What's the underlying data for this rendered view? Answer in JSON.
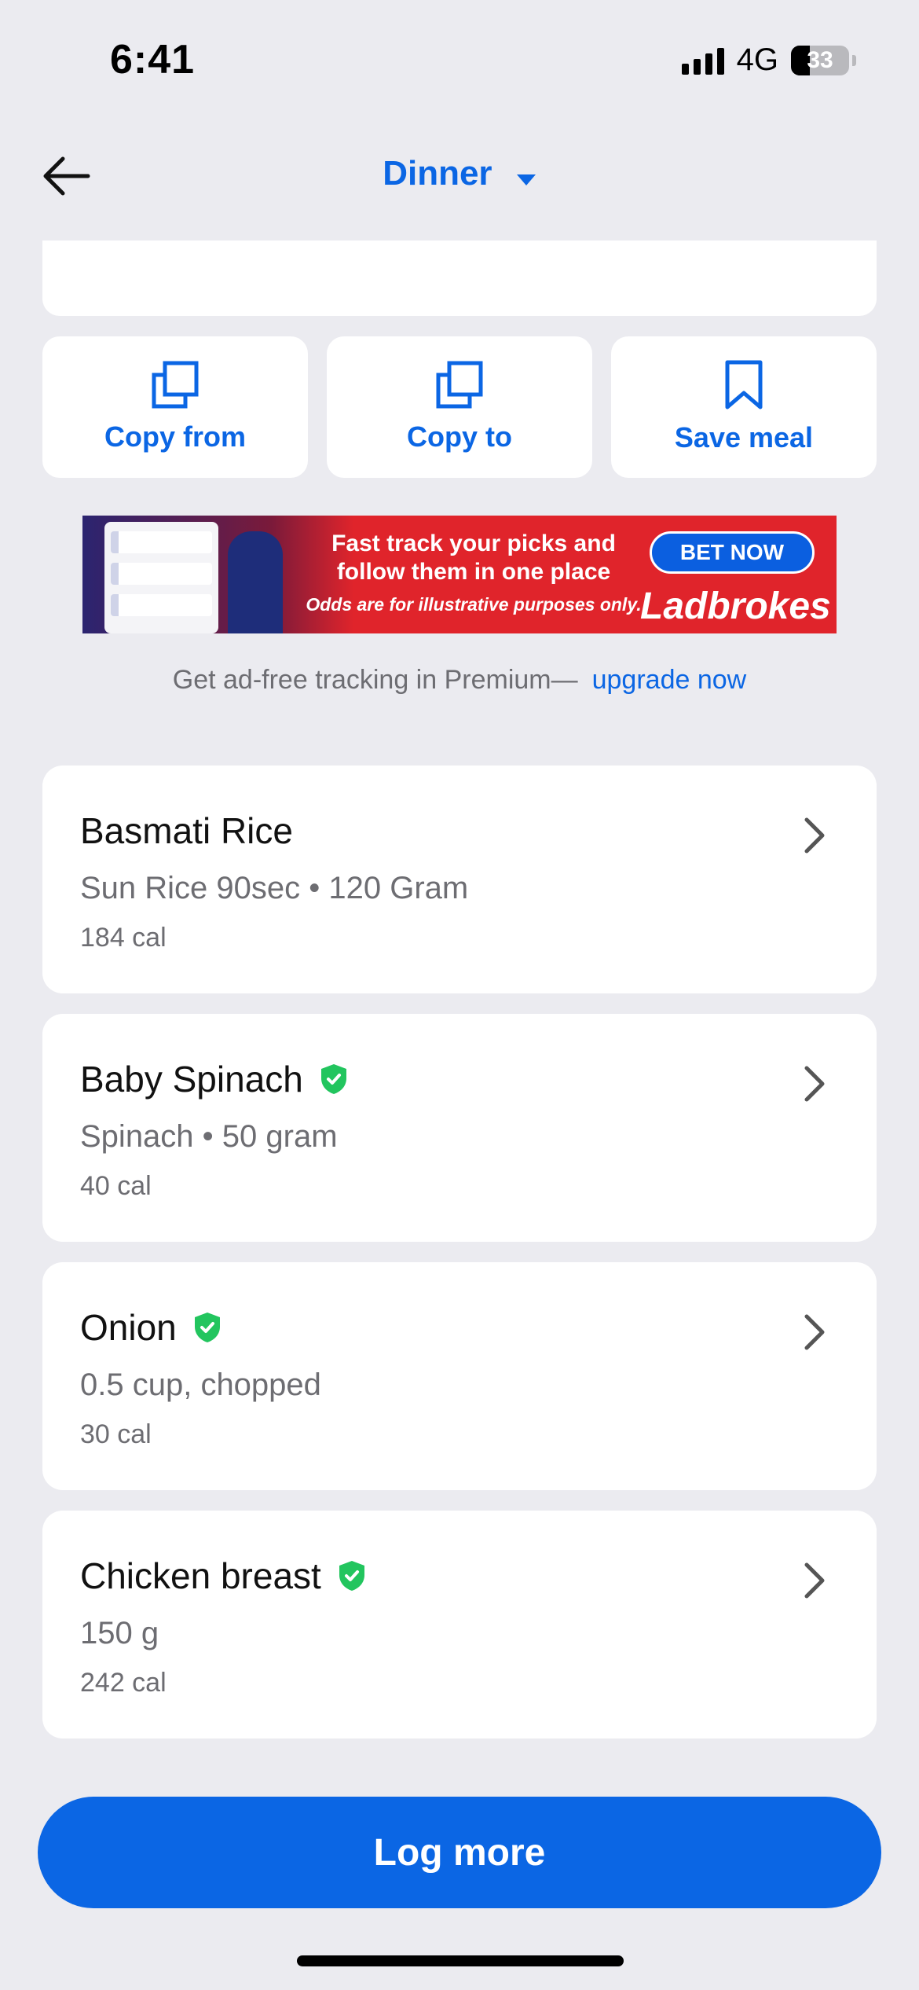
{
  "status_bar": {
    "time": "6:41",
    "network": "4G",
    "battery": "33"
  },
  "nav": {
    "title": "Dinner"
  },
  "actions": [
    {
      "label": "Copy from",
      "icon": "copy-icon"
    },
    {
      "label": "Copy to",
      "icon": "copy-icon"
    },
    {
      "label": "Save meal",
      "icon": "bookmark-icon"
    }
  ],
  "ad": {
    "headline_1": "Fast track your picks and",
    "headline_2": "follow them in one place",
    "disclaimer": "Odds are for illustrative purposes only.",
    "cta": "BET NOW",
    "brand": "Ladbrokes"
  },
  "premium": {
    "text": "Get ad-free tracking in Premium—",
    "link": "upgrade now"
  },
  "foods": [
    {
      "name": "Basmati Rice",
      "desc": "Sun Rice 90sec • 120 Gram",
      "cal": "184 cal",
      "verified": false
    },
    {
      "name": "Baby Spinach",
      "desc": "Spinach • 50 gram",
      "cal": "40 cal",
      "verified": true
    },
    {
      "name": "Onion",
      "desc": "0.5 cup, chopped",
      "cal": "30 cal",
      "verified": true
    },
    {
      "name": "Chicken breast",
      "desc": "150 g",
      "cal": "242 cal",
      "verified": true
    }
  ],
  "log_more_label": "Log more",
  "colors": {
    "accent": "#0b66e4",
    "verified": "#22c55e",
    "background": "#ebebf0"
  }
}
